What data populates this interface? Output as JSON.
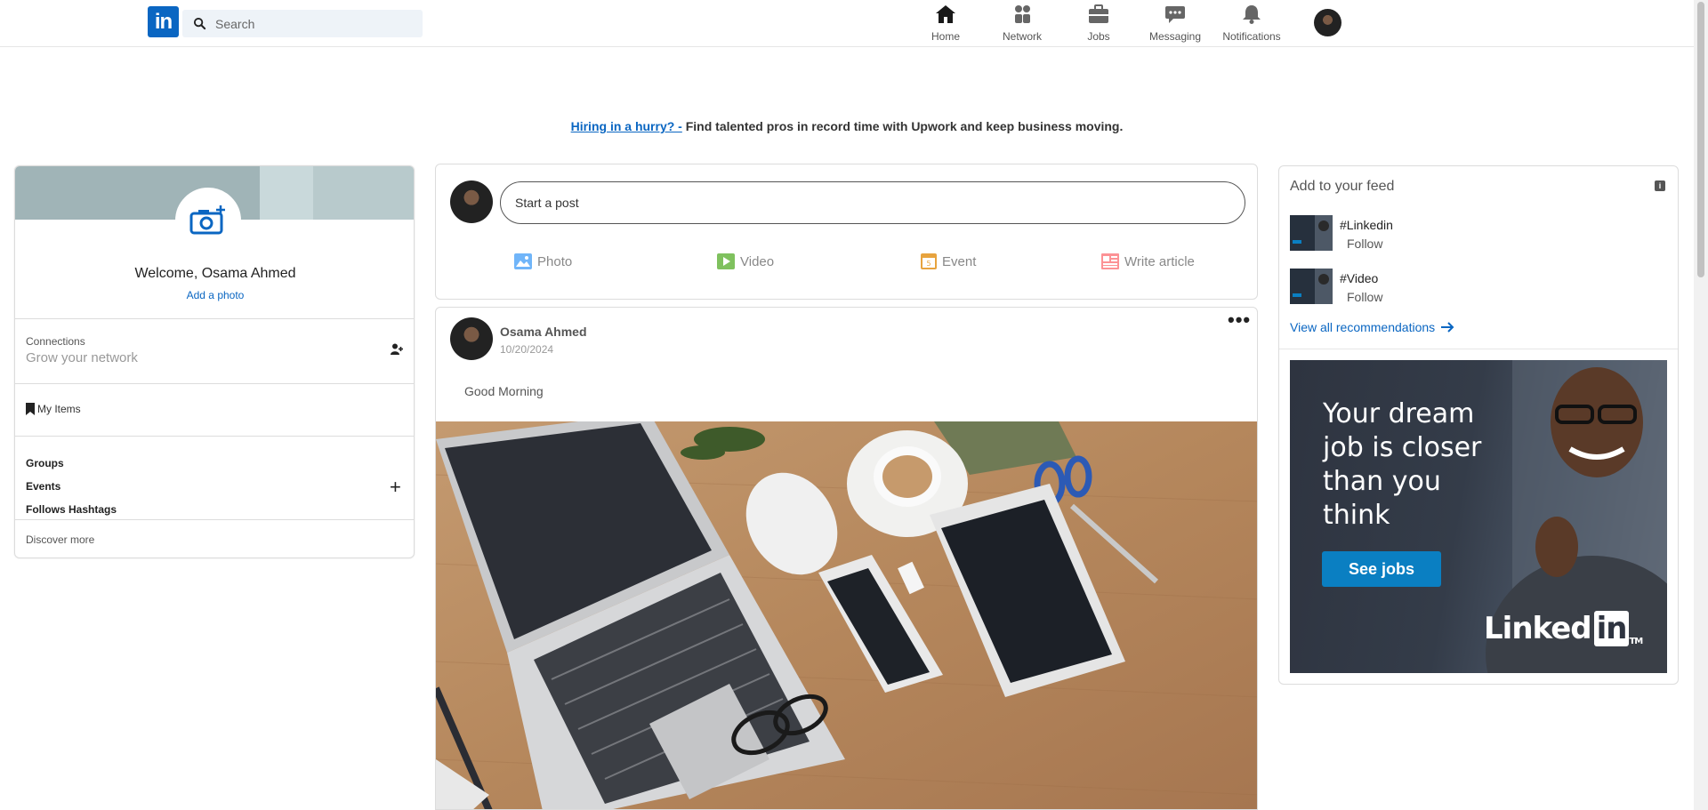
{
  "header": {
    "logo": "in",
    "search_placeholder": "Search",
    "nav": [
      {
        "label": "Home",
        "icon": "home-icon"
      },
      {
        "label": "Network",
        "icon": "network-icon"
      },
      {
        "label": "Jobs",
        "icon": "jobs-icon"
      },
      {
        "label": "Messaging",
        "icon": "messaging-icon"
      },
      {
        "label": "Notifications",
        "icon": "notifications-icon"
      }
    ]
  },
  "promo": {
    "link": "Hiring in a hurry? -",
    "text": " Find talented pros in record time with Upwork and keep business moving."
  },
  "profile": {
    "welcome": "Welcome, Osama Ahmed",
    "add_photo": "Add a photo",
    "connections_label": "Connections",
    "connections_sub": "Grow your network",
    "my_items": "My Items",
    "groups": "Groups",
    "events": "Events",
    "follows_hashtags": "Follows Hashtags",
    "discover_more": "Discover more"
  },
  "composer": {
    "placeholder": "Start a post",
    "actions": [
      {
        "label": "Photo",
        "icon": "photo-icon",
        "color": "#70b5f9"
      },
      {
        "label": "Video",
        "icon": "video-icon",
        "color": "#7fc15e"
      },
      {
        "label": "Event",
        "icon": "event-icon",
        "color": "#e7a33e"
      },
      {
        "label": "Write article",
        "icon": "article-icon",
        "color": "#fc9295"
      }
    ]
  },
  "post": {
    "author": "Osama Ahmed",
    "date": "10/20/2024",
    "text": "Good Morning",
    "more": "•••"
  },
  "feed": {
    "title": "Add to your feed",
    "info": "i",
    "items": [
      {
        "tag": "#Linkedin",
        "action": "Follow"
      },
      {
        "tag": "#Video",
        "action": "Follow"
      }
    ],
    "view_all": "View all recommendations"
  },
  "ad": {
    "headline": "Your dream job is closer than you think",
    "button": "See jobs",
    "brand": "Linked",
    "brand_in": "in",
    "tm": "TM"
  },
  "colors": {
    "brand": "#0a66c2"
  }
}
